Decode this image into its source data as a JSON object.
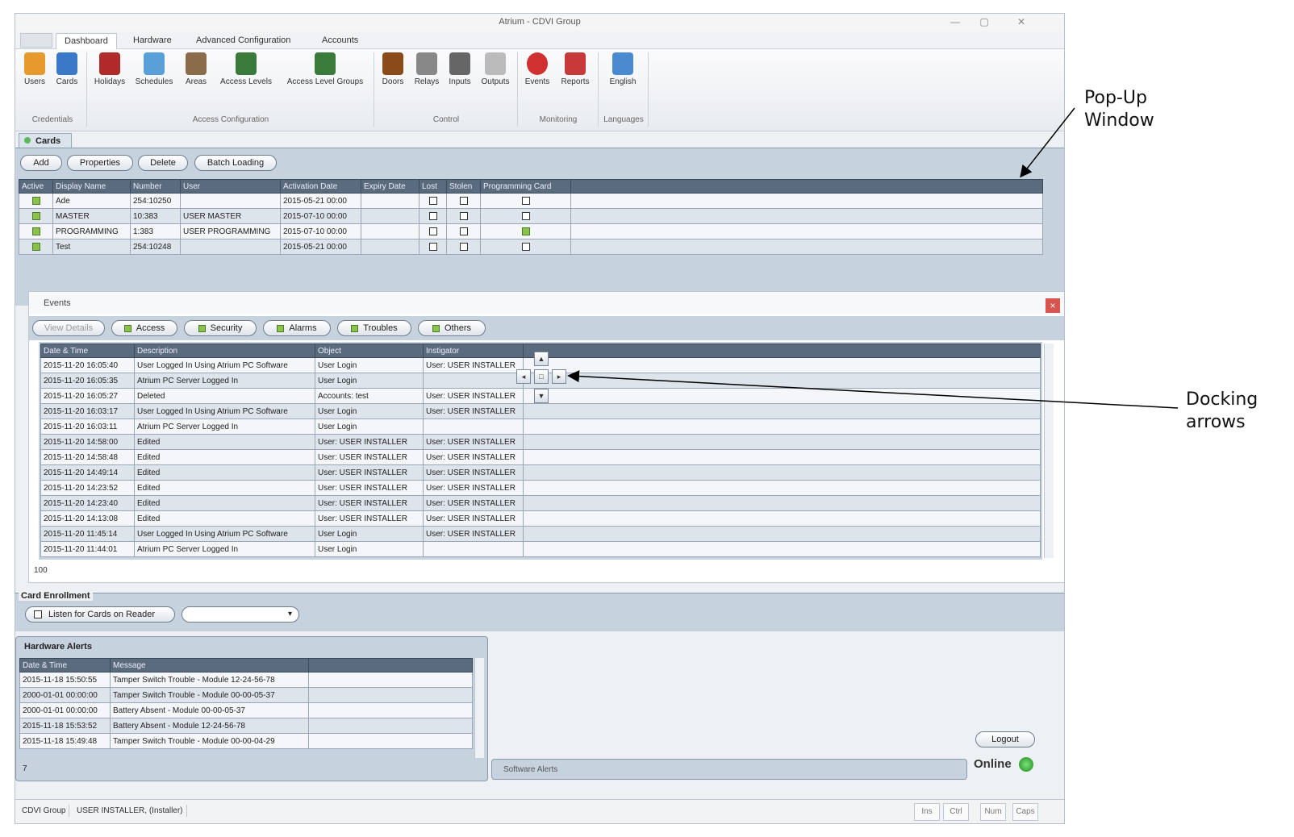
{
  "window": {
    "title": "Atrium - CDVI Group",
    "min": "—",
    "max": "▢",
    "close": "✕"
  },
  "ribbon": {
    "tabs": [
      "Dashboard",
      "Hardware",
      "Advanced Configuration",
      "Accounts"
    ],
    "buttons": [
      {
        "label": "Users",
        "icon": "users-icon",
        "color": "#e69a2e"
      },
      {
        "label": "Cards",
        "icon": "cards-icon",
        "color": "#3a78c8"
      },
      {
        "label": "Holidays",
        "icon": "holidays-icon",
        "color": "#b02a2a"
      },
      {
        "label": "Schedules",
        "icon": "schedules-icon",
        "color": "#5aa0d8"
      },
      {
        "label": "Areas",
        "icon": "areas-icon",
        "color": "#8a6b4a"
      },
      {
        "label": "Access Levels",
        "icon": "access-levels-icon",
        "color": "#3a7a3a"
      },
      {
        "label": "Access Level Groups",
        "icon": "access-level-groups-icon",
        "color": "#3a7a3a"
      },
      {
        "label": "Doors",
        "icon": "doors-icon",
        "color": "#8a4a1a"
      },
      {
        "label": "Relays",
        "icon": "relays-icon",
        "color": "#888888"
      },
      {
        "label": "Inputs",
        "icon": "inputs-icon",
        "color": "#666666"
      },
      {
        "label": "Outputs",
        "icon": "outputs-icon",
        "color": "#bbbbbb"
      },
      {
        "label": "Events",
        "icon": "events-icon",
        "color": "#d03030"
      },
      {
        "label": "Reports",
        "icon": "reports-icon",
        "color": "#c83a3a"
      },
      {
        "label": "English",
        "icon": "language-icon",
        "color": "#4a8ad0"
      }
    ],
    "groups": [
      "Credentials",
      "Access Configuration",
      "Control",
      "Monitoring",
      "Languages"
    ]
  },
  "cards": {
    "tab": "Cards",
    "actions": [
      "Add",
      "Properties",
      "Delete",
      "Batch Loading"
    ],
    "columns": [
      "Active",
      "Display Name",
      "Number",
      "User",
      "Activation Date",
      "Expiry Date",
      "Lost",
      "Stolen",
      "Programming Card"
    ],
    "rows": [
      {
        "active": true,
        "name": "Ade",
        "number": "254:10250",
        "user": "",
        "activation": "2015-05-21 00:00",
        "expiry": "",
        "lost": false,
        "stolen": false,
        "prog": false
      },
      {
        "active": true,
        "name": "MASTER",
        "number": "10:383",
        "user": "USER MASTER",
        "activation": "2015-07-10 00:00",
        "expiry": "",
        "lost": false,
        "stolen": false,
        "prog": false
      },
      {
        "active": true,
        "name": "PROGRAMMING",
        "number": "1:383",
        "user": "USER PROGRAMMING",
        "activation": "2015-07-10 00:00",
        "expiry": "",
        "lost": false,
        "stolen": false,
        "prog": true
      },
      {
        "active": true,
        "name": "Test",
        "number": "254:10248",
        "user": "",
        "activation": "2015-05-21 00:00",
        "expiry": "",
        "lost": false,
        "stolen": false,
        "prog": false
      }
    ]
  },
  "events": {
    "title": "Events",
    "close": "×",
    "view_details": "View Details",
    "filters": [
      "Access",
      "Security",
      "Alarms",
      "Troubles",
      "Others"
    ],
    "columns": [
      "Date & Time",
      "Description",
      "Object",
      "Instigator"
    ],
    "rows": [
      [
        "2015-11-20 16:05:40",
        "User Logged In Using Atrium PC Software",
        "User Login",
        "User: USER INSTALLER"
      ],
      [
        "2015-11-20 16:05:35",
        "Atrium PC Server Logged In",
        "User Login",
        ""
      ],
      [
        "2015-11-20 16:05:27",
        "Deleted",
        "Accounts: test",
        "User: USER INSTALLER"
      ],
      [
        "2015-11-20 16:03:17",
        "User Logged In Using Atrium PC Software",
        "User Login",
        "User: USER INSTALLER"
      ],
      [
        "2015-11-20 16:03:11",
        "Atrium PC Server Logged In",
        "User Login",
        ""
      ],
      [
        "2015-11-20 14:58:00",
        "Edited",
        "User: USER INSTALLER",
        "User: USER INSTALLER"
      ],
      [
        "2015-11-20 14:58:48",
        "Edited",
        "User: USER INSTALLER",
        "User: USER INSTALLER"
      ],
      [
        "2015-11-20 14:49:14",
        "Edited",
        "User: USER INSTALLER",
        "User: USER INSTALLER"
      ],
      [
        "2015-11-20 14:23:52",
        "Edited",
        "User: USER INSTALLER",
        "User: USER INSTALLER"
      ],
      [
        "2015-11-20 14:23:40",
        "Edited",
        "User: USER INSTALLER",
        "User: USER INSTALLER"
      ],
      [
        "2015-11-20 14:13:08",
        "Edited",
        "User: USER INSTALLER",
        "User: USER INSTALLER"
      ],
      [
        "2015-11-20 11:45:14",
        "User Logged In Using Atrium PC Software",
        "User Login",
        "User: USER INSTALLER"
      ],
      [
        "2015-11-20 11:44:01",
        "Atrium PC Server Logged In",
        "User Login",
        ""
      ]
    ],
    "count": "100",
    "dock": {
      "up": "▲",
      "left": "◂",
      "center": "□",
      "right": "▸",
      "down": "▼"
    }
  },
  "enrollment": {
    "title": "Card Enrollment",
    "listen": "Listen for Cards on Reader",
    "select_value": "",
    "arrow": "▾"
  },
  "hardware_alerts": {
    "title": "Hardware Alerts",
    "columns": [
      "Date & Time",
      "Message"
    ],
    "rows": [
      [
        "2015-11-18 15:50:55",
        "Tamper Switch Trouble - Module 12-24-56-78"
      ],
      [
        "2000-01-01 00:00:00",
        "Tamper Switch Trouble - Module 00-00-05-37"
      ],
      [
        "2000-01-01 00:00:00",
        "Battery Absent - Module 00-00-05-37"
      ],
      [
        "2015-11-18 15:53:52",
        "Battery Absent - Module 12-24-56-78"
      ],
      [
        "2015-11-18 15:49:48",
        "Tamper Switch Trouble - Module 00-00-04-29"
      ]
    ],
    "count": "7"
  },
  "software_alerts": {
    "title": "Software Alerts"
  },
  "session": {
    "logout": "Logout",
    "status": "Online"
  },
  "statusbar": {
    "company": "CDVI Group",
    "user": "USER INSTALLER, (Installer)",
    "indicators": [
      "Ins",
      "Ctrl",
      "Num",
      "Caps"
    ]
  },
  "annotations": {
    "popup": [
      "Pop-Up",
      "Window"
    ],
    "docking": [
      "Docking",
      "arrows"
    ]
  }
}
